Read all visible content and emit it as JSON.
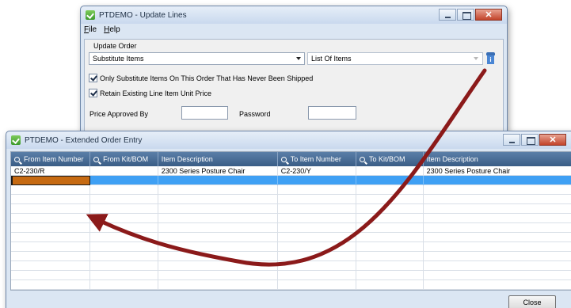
{
  "update_lines": {
    "title": "PTDEMO - Update Lines",
    "menu": [
      "File",
      "Help"
    ],
    "group_label": "Update Order",
    "action_combo": "Substitute Items",
    "list_combo": "List Of Items",
    "checkbox_1": "Only Substitute Items On This Order That Has Never Been Shipped",
    "checkbox_1_checked": true,
    "checkbox_2": "Retain Existing Line Item Unit Price",
    "checkbox_2_checked": true,
    "price_approved_label": "Price Approved By",
    "price_approved_value": "",
    "password_label": "Password",
    "password_value": ""
  },
  "order_entry": {
    "title": "PTDEMO - Extended Order Entry",
    "columns": [
      {
        "label": "From Item Number",
        "searchable": true
      },
      {
        "label": "From Kit/BOM",
        "searchable": true
      },
      {
        "label": "Item Description",
        "searchable": false
      },
      {
        "label": "To Item Number",
        "searchable": true
      },
      {
        "label": "To Kit/BOM",
        "searchable": true
      },
      {
        "label": "Item Description",
        "searchable": false
      }
    ],
    "rows": [
      [
        "C2-230/R",
        "",
        "2300 Series Posture Chair",
        "C2-230/Y",
        "",
        "2300 Series Posture Chair"
      ],
      [
        "",
        "",
        "",
        "",
        "",
        ""
      ]
    ],
    "close_button": "Close"
  },
  "colors": {
    "grid_header": "#4a6f99",
    "selected_row": "#3fa0f4",
    "active_cell": "#c66a12",
    "arrow": "#8b1a1a"
  },
  "icons": [
    "check-app-icon",
    "minimize-icon",
    "maximize-icon",
    "close-icon",
    "search-icon",
    "info-icon",
    "dropdown-arrow-icon"
  ]
}
